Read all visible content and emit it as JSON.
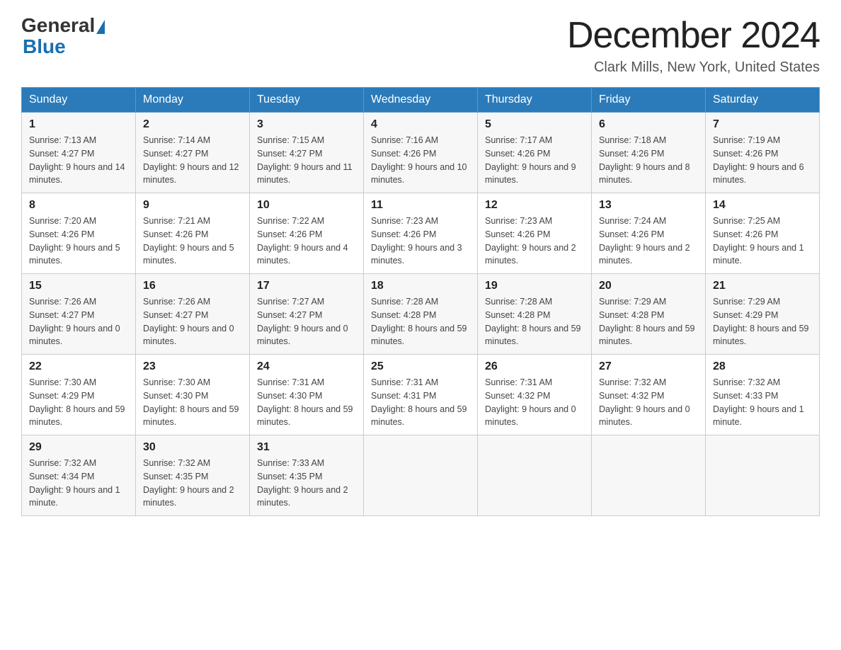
{
  "header": {
    "logo_general": "General",
    "logo_blue": "Blue",
    "month_title": "December 2024",
    "location": "Clark Mills, New York, United States"
  },
  "weekdays": [
    "Sunday",
    "Monday",
    "Tuesday",
    "Wednesday",
    "Thursday",
    "Friday",
    "Saturday"
  ],
  "weeks": [
    [
      {
        "day": "1",
        "sunrise": "7:13 AM",
        "sunset": "4:27 PM",
        "daylight": "9 hours and 14 minutes."
      },
      {
        "day": "2",
        "sunrise": "7:14 AM",
        "sunset": "4:27 PM",
        "daylight": "9 hours and 12 minutes."
      },
      {
        "day": "3",
        "sunrise": "7:15 AM",
        "sunset": "4:27 PM",
        "daylight": "9 hours and 11 minutes."
      },
      {
        "day": "4",
        "sunrise": "7:16 AM",
        "sunset": "4:26 PM",
        "daylight": "9 hours and 10 minutes."
      },
      {
        "day": "5",
        "sunrise": "7:17 AM",
        "sunset": "4:26 PM",
        "daylight": "9 hours and 9 minutes."
      },
      {
        "day": "6",
        "sunrise": "7:18 AM",
        "sunset": "4:26 PM",
        "daylight": "9 hours and 8 minutes."
      },
      {
        "day": "7",
        "sunrise": "7:19 AM",
        "sunset": "4:26 PM",
        "daylight": "9 hours and 6 minutes."
      }
    ],
    [
      {
        "day": "8",
        "sunrise": "7:20 AM",
        "sunset": "4:26 PM",
        "daylight": "9 hours and 5 minutes."
      },
      {
        "day": "9",
        "sunrise": "7:21 AM",
        "sunset": "4:26 PM",
        "daylight": "9 hours and 5 minutes."
      },
      {
        "day": "10",
        "sunrise": "7:22 AM",
        "sunset": "4:26 PM",
        "daylight": "9 hours and 4 minutes."
      },
      {
        "day": "11",
        "sunrise": "7:23 AM",
        "sunset": "4:26 PM",
        "daylight": "9 hours and 3 minutes."
      },
      {
        "day": "12",
        "sunrise": "7:23 AM",
        "sunset": "4:26 PM",
        "daylight": "9 hours and 2 minutes."
      },
      {
        "day": "13",
        "sunrise": "7:24 AM",
        "sunset": "4:26 PM",
        "daylight": "9 hours and 2 minutes."
      },
      {
        "day": "14",
        "sunrise": "7:25 AM",
        "sunset": "4:26 PM",
        "daylight": "9 hours and 1 minute."
      }
    ],
    [
      {
        "day": "15",
        "sunrise": "7:26 AM",
        "sunset": "4:27 PM",
        "daylight": "9 hours and 0 minutes."
      },
      {
        "day": "16",
        "sunrise": "7:26 AM",
        "sunset": "4:27 PM",
        "daylight": "9 hours and 0 minutes."
      },
      {
        "day": "17",
        "sunrise": "7:27 AM",
        "sunset": "4:27 PM",
        "daylight": "9 hours and 0 minutes."
      },
      {
        "day": "18",
        "sunrise": "7:28 AM",
        "sunset": "4:28 PM",
        "daylight": "8 hours and 59 minutes."
      },
      {
        "day": "19",
        "sunrise": "7:28 AM",
        "sunset": "4:28 PM",
        "daylight": "8 hours and 59 minutes."
      },
      {
        "day": "20",
        "sunrise": "7:29 AM",
        "sunset": "4:28 PM",
        "daylight": "8 hours and 59 minutes."
      },
      {
        "day": "21",
        "sunrise": "7:29 AM",
        "sunset": "4:29 PM",
        "daylight": "8 hours and 59 minutes."
      }
    ],
    [
      {
        "day": "22",
        "sunrise": "7:30 AM",
        "sunset": "4:29 PM",
        "daylight": "8 hours and 59 minutes."
      },
      {
        "day": "23",
        "sunrise": "7:30 AM",
        "sunset": "4:30 PM",
        "daylight": "8 hours and 59 minutes."
      },
      {
        "day": "24",
        "sunrise": "7:31 AM",
        "sunset": "4:30 PM",
        "daylight": "8 hours and 59 minutes."
      },
      {
        "day": "25",
        "sunrise": "7:31 AM",
        "sunset": "4:31 PM",
        "daylight": "8 hours and 59 minutes."
      },
      {
        "day": "26",
        "sunrise": "7:31 AM",
        "sunset": "4:32 PM",
        "daylight": "9 hours and 0 minutes."
      },
      {
        "day": "27",
        "sunrise": "7:32 AM",
        "sunset": "4:32 PM",
        "daylight": "9 hours and 0 minutes."
      },
      {
        "day": "28",
        "sunrise": "7:32 AM",
        "sunset": "4:33 PM",
        "daylight": "9 hours and 1 minute."
      }
    ],
    [
      {
        "day": "29",
        "sunrise": "7:32 AM",
        "sunset": "4:34 PM",
        "daylight": "9 hours and 1 minute."
      },
      {
        "day": "30",
        "sunrise": "7:32 AM",
        "sunset": "4:35 PM",
        "daylight": "9 hours and 2 minutes."
      },
      {
        "day": "31",
        "sunrise": "7:33 AM",
        "sunset": "4:35 PM",
        "daylight": "9 hours and 2 minutes."
      },
      null,
      null,
      null,
      null
    ]
  ],
  "labels": {
    "sunrise": "Sunrise:",
    "sunset": "Sunset:",
    "daylight": "Daylight:"
  }
}
